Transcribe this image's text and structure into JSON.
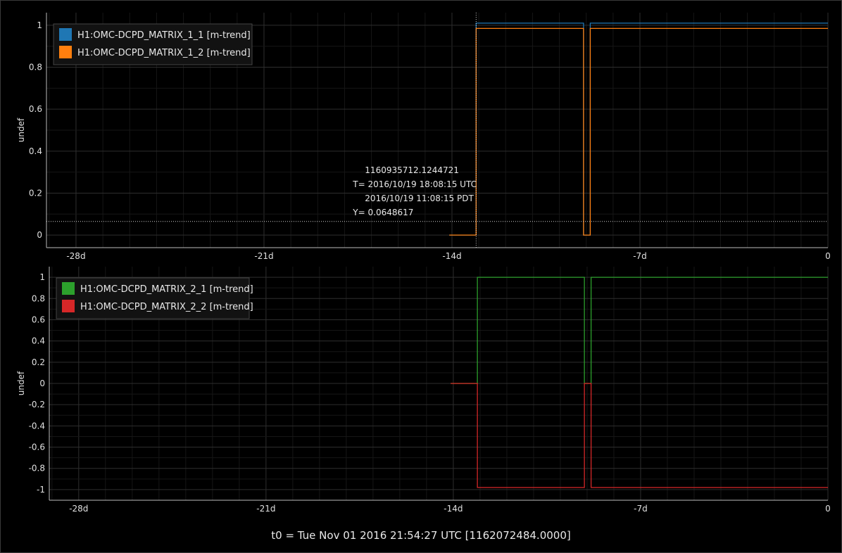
{
  "footer": "t0 = Tue Nov 01 2016 21:54:27 UTC [1162072484.0000]",
  "cursor": {
    "gps": "1160935712.1244721",
    "utc": "T= 2016/10/19 18:08:15 UTC",
    "local": "2016/10/19 11:08:15 PDT",
    "y": "Y= 0.0648617"
  },
  "chart_data": [
    {
      "type": "line",
      "ylabel": "undef",
      "xlim": [
        -29.1,
        0
      ],
      "ylim": [
        -0.06,
        1.06
      ],
      "xticks": [
        -28,
        -21,
        -14,
        -7,
        0
      ],
      "xtick_labels": [
        "-28d",
        "-21d",
        "-14d",
        "-7d",
        "0"
      ],
      "yticks": [
        0,
        0.2,
        0.4,
        0.6,
        0.8,
        1
      ],
      "ytick_labels": [
        "0",
        "0.2",
        "0.4",
        "0.6",
        "0.8",
        "1"
      ],
      "legend": "top-left",
      "cursor_x": -13.1,
      "cursor_y": 0.0648617,
      "series": [
        {
          "name": "H1:OMC-DCPD_MATRIX_1_1 [m-trend]",
          "color": "#1f77b4",
          "x": [
            -14.1,
            -13.1,
            -13.1,
            -9.1,
            -9.1,
            -8.85,
            -8.85,
            0
          ],
          "y": [
            0,
            0,
            1.01,
            1.01,
            0,
            0,
            1.01,
            1.01
          ]
        },
        {
          "name": "H1:OMC-DCPD_MATRIX_1_2 [m-trend]",
          "color": "#ff7f0e",
          "x": [
            -14.1,
            -13.1,
            -13.1,
            -9.1,
            -9.1,
            -8.85,
            -8.85,
            0
          ],
          "y": [
            0,
            0,
            0.985,
            0.985,
            0,
            0,
            0.985,
            0.985
          ]
        }
      ]
    },
    {
      "type": "line",
      "ylabel": "undef",
      "xlim": [
        -29.1,
        0
      ],
      "ylim": [
        -1.1,
        1.1
      ],
      "xticks": [
        -28,
        -21,
        -14,
        -7,
        0
      ],
      "xtick_labels": [
        "-28d",
        "-21d",
        "-14d",
        "-7d",
        "0"
      ],
      "yticks": [
        -1,
        -0.8,
        -0.6,
        -0.4,
        -0.2,
        0,
        0.2,
        0.4,
        0.6,
        0.8,
        1
      ],
      "ytick_labels": [
        "-1",
        "-0.8",
        "-0.6",
        "-0.4",
        "-0.2",
        "0",
        "0.2",
        "0.4",
        "0.6",
        "0.8",
        "1"
      ],
      "legend": "top-left",
      "series": [
        {
          "name": "H1:OMC-DCPD_MATRIX_2_1 [m-trend]",
          "color": "#2ca02c",
          "x": [
            -14.1,
            -13.1,
            -13.1,
            -9.1,
            -9.1,
            -8.85,
            -8.85,
            0
          ],
          "y": [
            0,
            0,
            1.0,
            1.0,
            0,
            0,
            1.0,
            1.0
          ]
        },
        {
          "name": "H1:OMC-DCPD_MATRIX_2_2 [m-trend]",
          "color": "#d62728",
          "x": [
            -14.1,
            -13.1,
            -13.1,
            -9.1,
            -9.1,
            -8.85,
            -8.85,
            0
          ],
          "y": [
            0,
            0,
            -0.98,
            -0.98,
            0,
            0,
            -0.98,
            -0.98
          ]
        }
      ]
    }
  ]
}
